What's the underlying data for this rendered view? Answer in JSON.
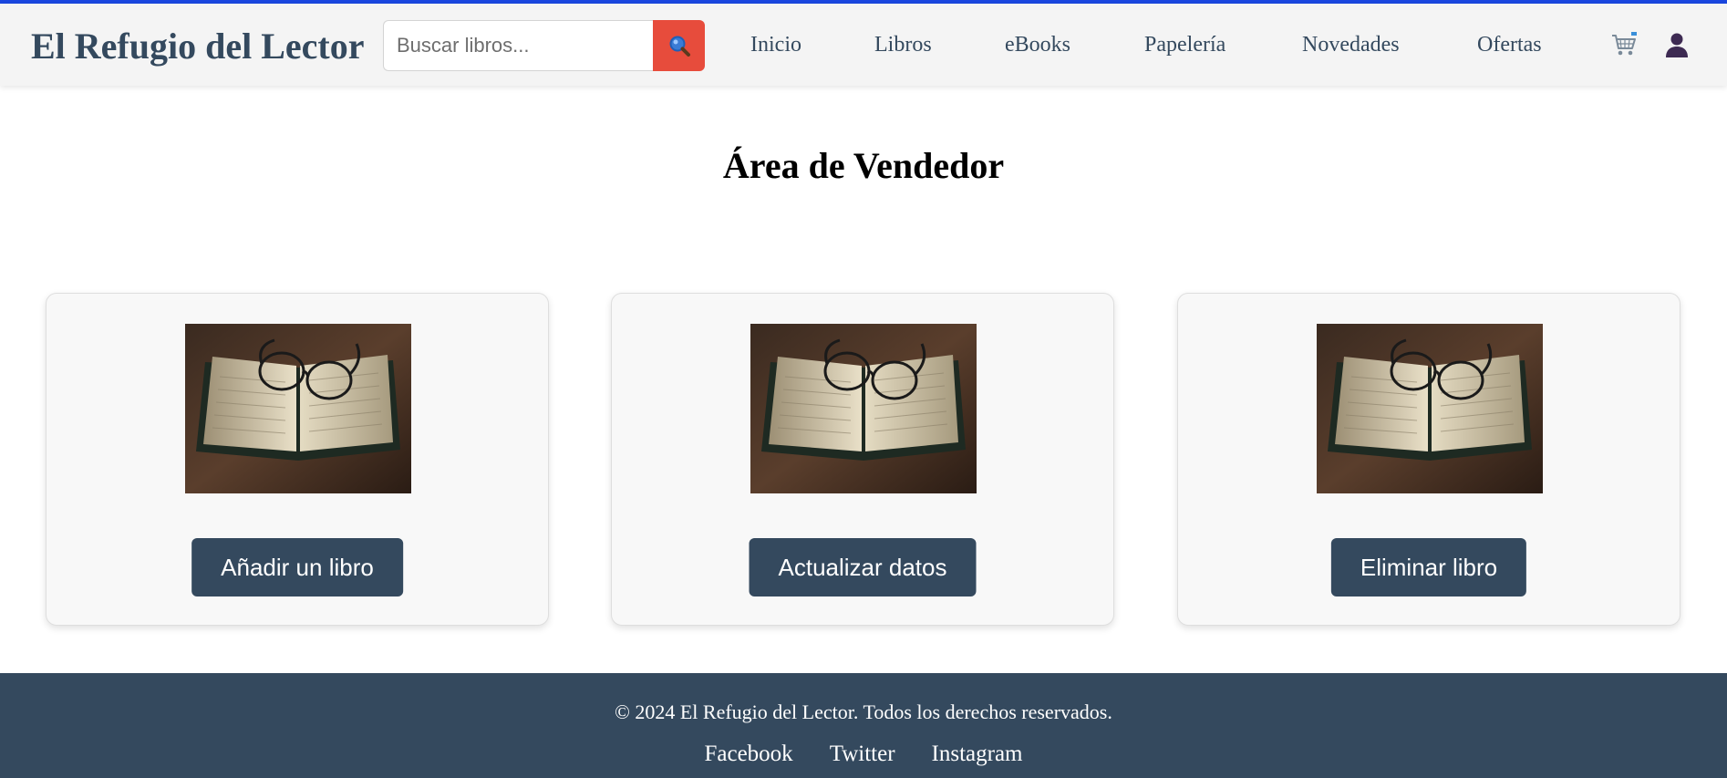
{
  "header": {
    "logo": "El Refugio del Lector",
    "search": {
      "placeholder": "Buscar libros...",
      "value": ""
    },
    "nav": [
      "Inicio",
      "Libros",
      "eBooks",
      "Papelería",
      "Novedades",
      "Ofertas"
    ],
    "icons": [
      "search-icon",
      "cart-icon",
      "user-icon"
    ]
  },
  "main": {
    "title": "Área de Vendedor",
    "cards": [
      {
        "image": "open-book-with-glasses",
        "button": "Añadir un libro"
      },
      {
        "image": "open-book-with-glasses",
        "button": "Actualizar datos"
      },
      {
        "image": "open-book-with-glasses",
        "button": "Eliminar libro"
      }
    ]
  },
  "footer": {
    "copyright": "© 2024 El Refugio del Lector. Todos los derechos reservados.",
    "links": [
      "Facebook",
      "Twitter",
      "Instagram"
    ]
  },
  "colors": {
    "accent_top": "#1a47e0",
    "primary": "#34495e",
    "search_button": "#e74c3c",
    "header_bg": "#f4f4f4",
    "card_bg": "#f8f8f8"
  }
}
